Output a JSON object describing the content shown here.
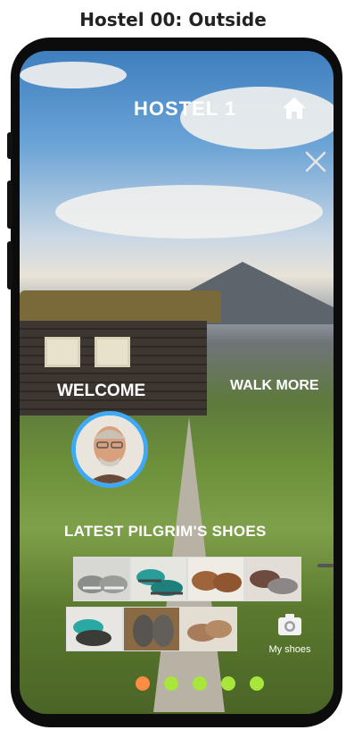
{
  "frame_title": "Hostel 00: Outside",
  "header": {
    "title": "HOSTEL 1"
  },
  "icons": {
    "home": "home-icon",
    "close": "close-icon",
    "camera": "camera-icon"
  },
  "labels": {
    "welcome": "WELCOME",
    "walk_more": "WALK  MORE",
    "latest_shoes": "LATEST PILGRIM'S SHOES",
    "my_shoes": "My shoes"
  },
  "colors": {
    "avatar_ring": "#3fa9f5",
    "dot_active": "#ff8c42",
    "dot_inactive": "#a8e63c"
  },
  "pagination": {
    "total": 5,
    "active_index": 0
  }
}
